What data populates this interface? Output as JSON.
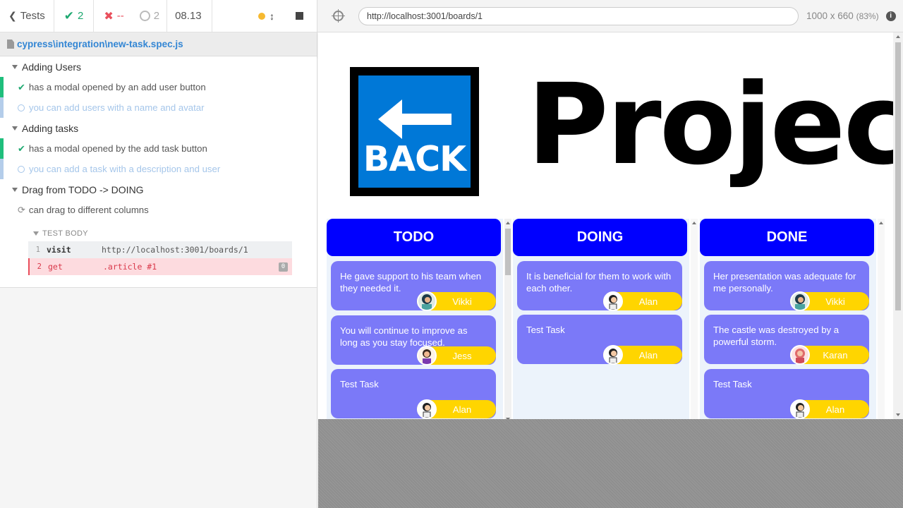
{
  "reporter": {
    "back_label": "Tests",
    "passed": "2",
    "failed": "--",
    "pending": "2",
    "duration": "08.13",
    "spec_path": "cypress\\integration\\new-task.spec.js"
  },
  "tests": [
    {
      "kind": "suite",
      "label": "Adding Users"
    },
    {
      "kind": "pass",
      "label": "has a modal opened by an add user button"
    },
    {
      "kind": "pending",
      "label": "you can add users with a name and avatar"
    },
    {
      "kind": "suite",
      "label": "Adding tasks"
    },
    {
      "kind": "pass",
      "label": "has a modal opened by the add task button"
    },
    {
      "kind": "pending",
      "label": "you can add a task with a description and user"
    },
    {
      "kind": "suite",
      "label": "Drag from TODO -> DOING"
    },
    {
      "kind": "running",
      "label": "can drag to different columns"
    }
  ],
  "test_body": {
    "label": "TEST BODY",
    "commands": [
      {
        "n": "1",
        "cmd": "visit",
        "arg": "http://localhost:3001/boards/1",
        "state": "ok"
      },
      {
        "n": "2",
        "cmd": "get",
        "arg": ".article #1",
        "state": "err",
        "badge": "0"
      }
    ]
  },
  "runner": {
    "url": "http://localhost:3001/boards/1",
    "size": "1000 x 660",
    "scale": "(83%)"
  },
  "app": {
    "back_label": "BACK",
    "title": "Project",
    "columns": [
      {
        "name": "TODO",
        "cards": [
          {
            "text": "He gave support to his team when they needed it.",
            "user": "Vikki"
          },
          {
            "text": "You will continue to improve as long as you stay focused.",
            "user": "Jess"
          },
          {
            "text": "Test Task",
            "user": "Alan"
          }
        ]
      },
      {
        "name": "DOING",
        "cards": [
          {
            "text": "It is beneficial for them to work with each other.",
            "user": "Alan"
          },
          {
            "text": "Test Task",
            "user": "Alan"
          }
        ]
      },
      {
        "name": "DONE",
        "cards": [
          {
            "text": "Her presentation was adequate for me personally.",
            "user": "Vikki"
          },
          {
            "text": "The castle was destroyed by a powerful storm.",
            "user": "Karan"
          },
          {
            "text": "Test Task",
            "user": "Alan"
          }
        ]
      }
    ]
  },
  "colors": {
    "pass": "#1fa971",
    "fail": "#e94f5c",
    "column_header": "#0000ff",
    "card": "#7b79f8",
    "assignee": "#ffd500",
    "back_button": "#0078d7"
  }
}
